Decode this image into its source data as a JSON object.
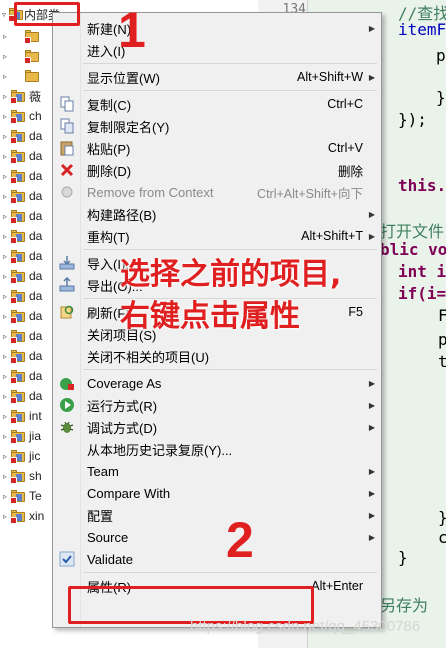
{
  "tree": {
    "selected_label": "内部类",
    "rows": [
      {
        "label": "",
        "arrow": "▹",
        "kind": "pkg"
      },
      {
        "label": "",
        "arrow": "▹",
        "kind": "pkg"
      },
      {
        "label": "",
        "arrow": "▹",
        "kind": "folder"
      },
      {
        "label": "薇",
        "arrow": "▹",
        "kind": "project"
      },
      {
        "label": "ch",
        "arrow": "▹",
        "kind": "project"
      },
      {
        "label": "da",
        "arrow": "▹",
        "kind": "project"
      },
      {
        "label": "da",
        "arrow": "▹",
        "kind": "project"
      },
      {
        "label": "da",
        "arrow": "▹",
        "kind": "project"
      },
      {
        "label": "da",
        "arrow": "▹",
        "kind": "project"
      },
      {
        "label": "da",
        "arrow": "▹",
        "kind": "project"
      },
      {
        "label": "da",
        "arrow": "▹",
        "kind": "project"
      },
      {
        "label": "da",
        "arrow": "▹",
        "kind": "project"
      },
      {
        "label": "da",
        "arrow": "▹",
        "kind": "project"
      },
      {
        "label": "da",
        "arrow": "▹",
        "kind": "project"
      },
      {
        "label": "da",
        "arrow": "▹",
        "kind": "project"
      },
      {
        "label": "da",
        "arrow": "▹",
        "kind": "project"
      },
      {
        "label": "da",
        "arrow": "▹",
        "kind": "project"
      },
      {
        "label": "da",
        "arrow": "▹",
        "kind": "project"
      },
      {
        "label": "da",
        "arrow": "▹",
        "kind": "project"
      },
      {
        "label": "int",
        "arrow": "▹",
        "kind": "project"
      },
      {
        "label": "jia",
        "arrow": "▹",
        "kind": "project"
      },
      {
        "label": "jic",
        "arrow": "▹",
        "kind": "project"
      },
      {
        "label": "sh",
        "arrow": "▹",
        "kind": "project"
      },
      {
        "label": "Te",
        "arrow": "▹",
        "kind": "project"
      },
      {
        "label": "xin",
        "arrow": "▹",
        "kind": "project"
      }
    ]
  },
  "editor": {
    "line_number": "134",
    "code_lines": [
      {
        "text": "//查找",
        "cls": "cm"
      },
      {
        "text": "itemF",
        "cls": "fd"
      },
      {
        "text": "p",
        "cls": ""
      },
      {
        "text": "}",
        "cls": ""
      },
      {
        "text": "});",
        "cls": ""
      },
      {
        "text": "this.",
        "cls": "kw"
      },
      {
        "text": "打开文件",
        "cls": "cm"
      },
      {
        "text": "blic vo",
        "cls": "kw"
      },
      {
        "text": "int i",
        "cls": "kw"
      },
      {
        "text": "if(i=",
        "cls": "kw"
      },
      {
        "text": "F",
        "cls": ""
      },
      {
        "text": "p",
        "cls": ""
      },
      {
        "text": "t",
        "cls": ""
      },
      {
        "text": "}",
        "cls": ""
      },
      {
        "text": "c",
        "cls": ""
      },
      {
        "text": "}",
        "cls": ""
      },
      {
        "text": "另存为",
        "cls": "cm"
      }
    ]
  },
  "menu": {
    "items": [
      {
        "label": "新建(N)",
        "shortcut": "",
        "sub": true,
        "icon": "",
        "disabled": false
      },
      {
        "label": "进入(I)",
        "shortcut": "",
        "sub": false,
        "icon": "",
        "disabled": false
      },
      {
        "sep": true
      },
      {
        "label": "显示位置(W)",
        "shortcut": "Alt+Shift+W",
        "sub": true,
        "icon": "",
        "disabled": false
      },
      {
        "sep": true
      },
      {
        "label": "复制(C)",
        "shortcut": "Ctrl+C",
        "sub": false,
        "icon": "copy-icon",
        "disabled": false
      },
      {
        "label": "复制限定名(Y)",
        "shortcut": "",
        "sub": false,
        "icon": "copy-qualified-icon",
        "disabled": false
      },
      {
        "label": "粘贴(P)",
        "shortcut": "Ctrl+V",
        "sub": false,
        "icon": "paste-icon",
        "disabled": false
      },
      {
        "label": "删除(D)",
        "shortcut": "删除",
        "sub": false,
        "icon": "delete-icon",
        "disabled": false
      },
      {
        "label": "Remove from Context",
        "shortcut": "Ctrl+Alt+Shift+向下",
        "sub": false,
        "icon": "remove-context-icon",
        "disabled": true
      },
      {
        "label": "构建路径(B)",
        "shortcut": "",
        "sub": true,
        "icon": "",
        "disabled": false
      },
      {
        "label": "重构(T)",
        "shortcut": "Alt+Shift+T",
        "sub": true,
        "icon": "",
        "disabled": false
      },
      {
        "sep": true
      },
      {
        "label": "导入(I)...",
        "shortcut": "",
        "sub": false,
        "icon": "import-icon",
        "disabled": false
      },
      {
        "label": "导出(O)...",
        "shortcut": "",
        "sub": false,
        "icon": "export-icon",
        "disabled": false
      },
      {
        "sep": true
      },
      {
        "label": "刷新(F)",
        "shortcut": "F5",
        "sub": false,
        "icon": "refresh-icon",
        "disabled": false
      },
      {
        "label": "关闭项目(S)",
        "shortcut": "",
        "sub": false,
        "icon": "",
        "disabled": false
      },
      {
        "label": "关闭不相关的项目(U)",
        "shortcut": "",
        "sub": false,
        "icon": "",
        "disabled": false
      },
      {
        "sep": true
      },
      {
        "label": "Coverage As",
        "shortcut": "",
        "sub": true,
        "icon": "coverage-icon",
        "disabled": false
      },
      {
        "label": "运行方式(R)",
        "shortcut": "",
        "sub": true,
        "icon": "run-icon",
        "disabled": false
      },
      {
        "label": "调试方式(D)",
        "shortcut": "",
        "sub": true,
        "icon": "debug-icon",
        "disabled": false
      },
      {
        "label": "从本地历史记录复原(Y)...",
        "shortcut": "",
        "sub": false,
        "icon": "",
        "disabled": false
      },
      {
        "label": "Team",
        "shortcut": "",
        "sub": true,
        "icon": "",
        "disabled": false
      },
      {
        "label": "Compare With",
        "shortcut": "",
        "sub": true,
        "icon": "",
        "disabled": false
      },
      {
        "label": "配置",
        "shortcut": "",
        "sub": true,
        "icon": "",
        "disabled": false
      },
      {
        "label": "Source",
        "shortcut": "",
        "sub": true,
        "icon": "",
        "disabled": false
      },
      {
        "label": "Validate",
        "shortcut": "",
        "sub": false,
        "icon": "check-icon",
        "disabled": false
      },
      {
        "sep": true
      },
      {
        "label": "属性(R)",
        "shortcut": "Alt+Enter",
        "sub": false,
        "icon": "",
        "disabled": false
      }
    ]
  },
  "annotations": {
    "step1": "1",
    "step2": "2",
    "instruction_line1": "选择之前的项目,",
    "instruction_line2": "右键点击属性",
    "color": "#e02020"
  },
  "watermark": "https://blog.csdn.net/qq_45300786"
}
